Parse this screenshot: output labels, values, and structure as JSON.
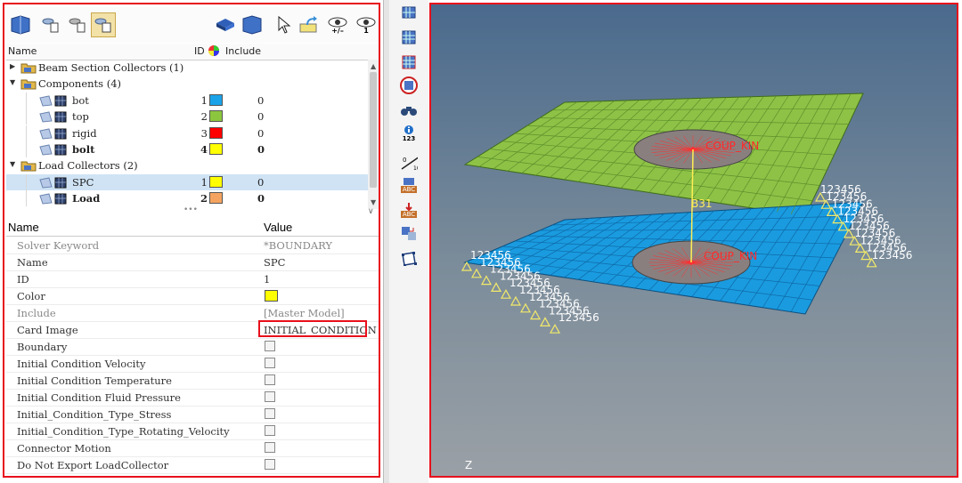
{
  "toolbar": {
    "left_icons": [
      "model-view-icon",
      "filter-icon-1",
      "filter-icon-2",
      "filter-icon-3"
    ],
    "right_icons": [
      "component-icon",
      "view-dropdown-icon",
      "cursor-icon",
      "export-icon",
      "visibility-icon",
      "visibility-plusminus-icon",
      "visibility-one-icon"
    ],
    "visibility_plusminus_label": "+/–",
    "visibility_one_label": "1"
  },
  "tree": {
    "headers": {
      "name": "Name",
      "id": "ID",
      "include": "Include"
    },
    "more_indicator": "•••",
    "rows": [
      {
        "label": "Beam Section Collectors (1)",
        "level": 0,
        "group": true,
        "expanded": false
      },
      {
        "label": "Components (4)",
        "level": 0,
        "group": true,
        "expanded": true
      },
      {
        "label": "bot",
        "level": 1,
        "id": "1",
        "color": "#1aa3e8",
        "include": "0",
        "bold": false
      },
      {
        "label": "top",
        "level": 1,
        "id": "2",
        "color": "#8cc63f",
        "include": "0",
        "bold": false
      },
      {
        "label": "rigid",
        "level": 1,
        "id": "3",
        "color": "#ff0000",
        "include": "0",
        "bold": false
      },
      {
        "label": "bolt",
        "level": 1,
        "id": "4",
        "color": "#ffff00",
        "include": "0",
        "bold": true
      },
      {
        "label": "Load Collectors (2)",
        "level": 0,
        "group": true,
        "expanded": true
      },
      {
        "label": "SPC",
        "level": 1,
        "id": "1",
        "color": "#ffff00",
        "include": "0",
        "bold": false,
        "selected": true
      },
      {
        "label": "Load",
        "level": 1,
        "id": "2",
        "color": "#f4a460",
        "include": "0",
        "bold": true
      }
    ]
  },
  "props": {
    "headers": {
      "name": "Name",
      "value": "Value"
    },
    "rows": [
      {
        "name": "Solver Keyword",
        "value": "*BOUNDARY",
        "kind": "text",
        "dim": true
      },
      {
        "name": "Name",
        "value": "SPC",
        "kind": "text"
      },
      {
        "name": "ID",
        "value": "1",
        "kind": "text"
      },
      {
        "name": "Color",
        "value": "",
        "kind": "color",
        "color": "#ffff00"
      },
      {
        "name": "Include",
        "value": "[Master Model]",
        "kind": "text",
        "dim": true
      },
      {
        "name": "Card Image",
        "value": "INITIAL_CONDITION",
        "kind": "text",
        "highlight": true
      },
      {
        "name": "Boundary",
        "value": "",
        "kind": "checkbox"
      },
      {
        "name": "Initial Condition Velocity",
        "value": "",
        "kind": "checkbox"
      },
      {
        "name": "Initial Condition Temperature",
        "value": "",
        "kind": "checkbox"
      },
      {
        "name": "Initial Condition Fluid Pressure",
        "value": "",
        "kind": "checkbox"
      },
      {
        "name": "Initial_Condition_Type_Stress",
        "value": "",
        "kind": "checkbox"
      },
      {
        "name": "Initial_Condition_Type_Rotating_Velocity",
        "value": "",
        "kind": "checkbox"
      },
      {
        "name": "Connector Motion",
        "value": "",
        "kind": "checkbox"
      },
      {
        "name": "Do Not Export LoadCollector",
        "value": "",
        "kind": "checkbox"
      }
    ]
  },
  "vertical_toolbar": {
    "icons": [
      "mesh-icon-1",
      "mesh-icon-2",
      "mesh-icon-3",
      "mesh-target-icon",
      "binoculars-icon",
      "info-icon",
      "scale-icon",
      "arc-icon-1",
      "arc-icon-2",
      "transform-icon",
      "box-icon"
    ],
    "info_label": "123",
    "scale_label": "10",
    "arc_label": "ABC"
  },
  "viewport": {
    "label_top": "COUP_KIN",
    "label_bottom": "COUP_KIN",
    "beam_label": "B31",
    "dof_label": "123456",
    "axis_label": "Z",
    "top_color": "#8ec246",
    "bottom_color": "#1a9be0",
    "circle_color": "#8a7f7f"
  }
}
